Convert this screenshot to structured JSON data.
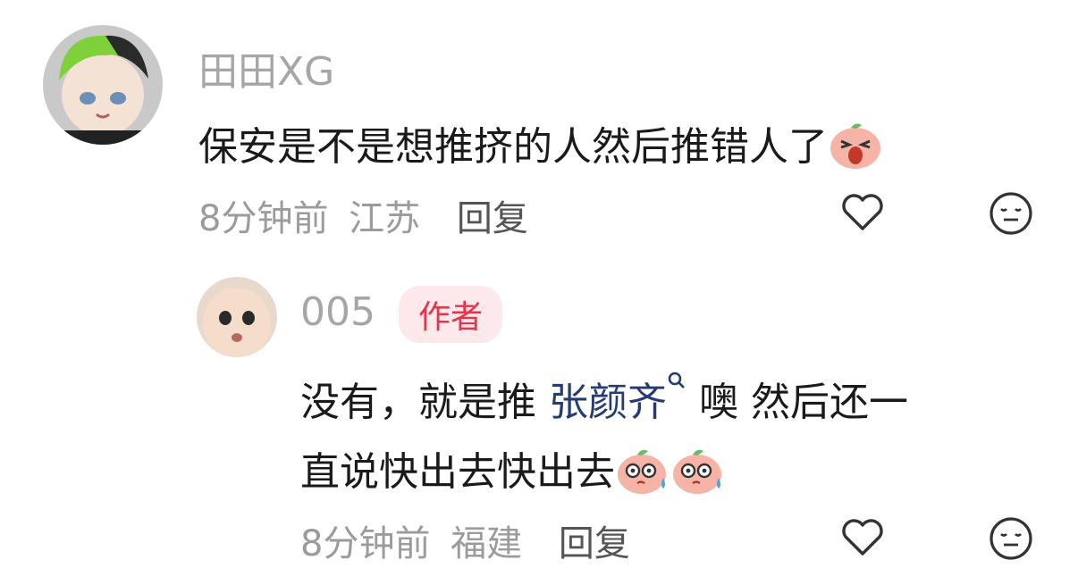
{
  "comments": [
    {
      "username": "田田XG",
      "text": "保安是不是想推挤的人然后推错人了",
      "time": "8分钟前",
      "location": "江苏",
      "reply_label": "回复",
      "emoji": "screaming-peach-emoji"
    },
    {
      "username": "005",
      "badge": "作者",
      "text_before": "没有，就是推",
      "mention": "张颜齐",
      "text_after": "噢 然后还一",
      "text_line2": "直说快出去快出去",
      "time": "8分钟前",
      "location": "福建",
      "reply_label": "回复",
      "emoji": "sweating-peach-emoji"
    }
  ],
  "icons": {
    "like": "heart-outline-icon",
    "dislike": "meh-face-icon",
    "search": "search-icon"
  },
  "colors": {
    "author_badge_bg": "#fde8ec",
    "author_badge_text": "#e8334a",
    "mention": "#253b73",
    "meta": "#9b9b9b"
  }
}
